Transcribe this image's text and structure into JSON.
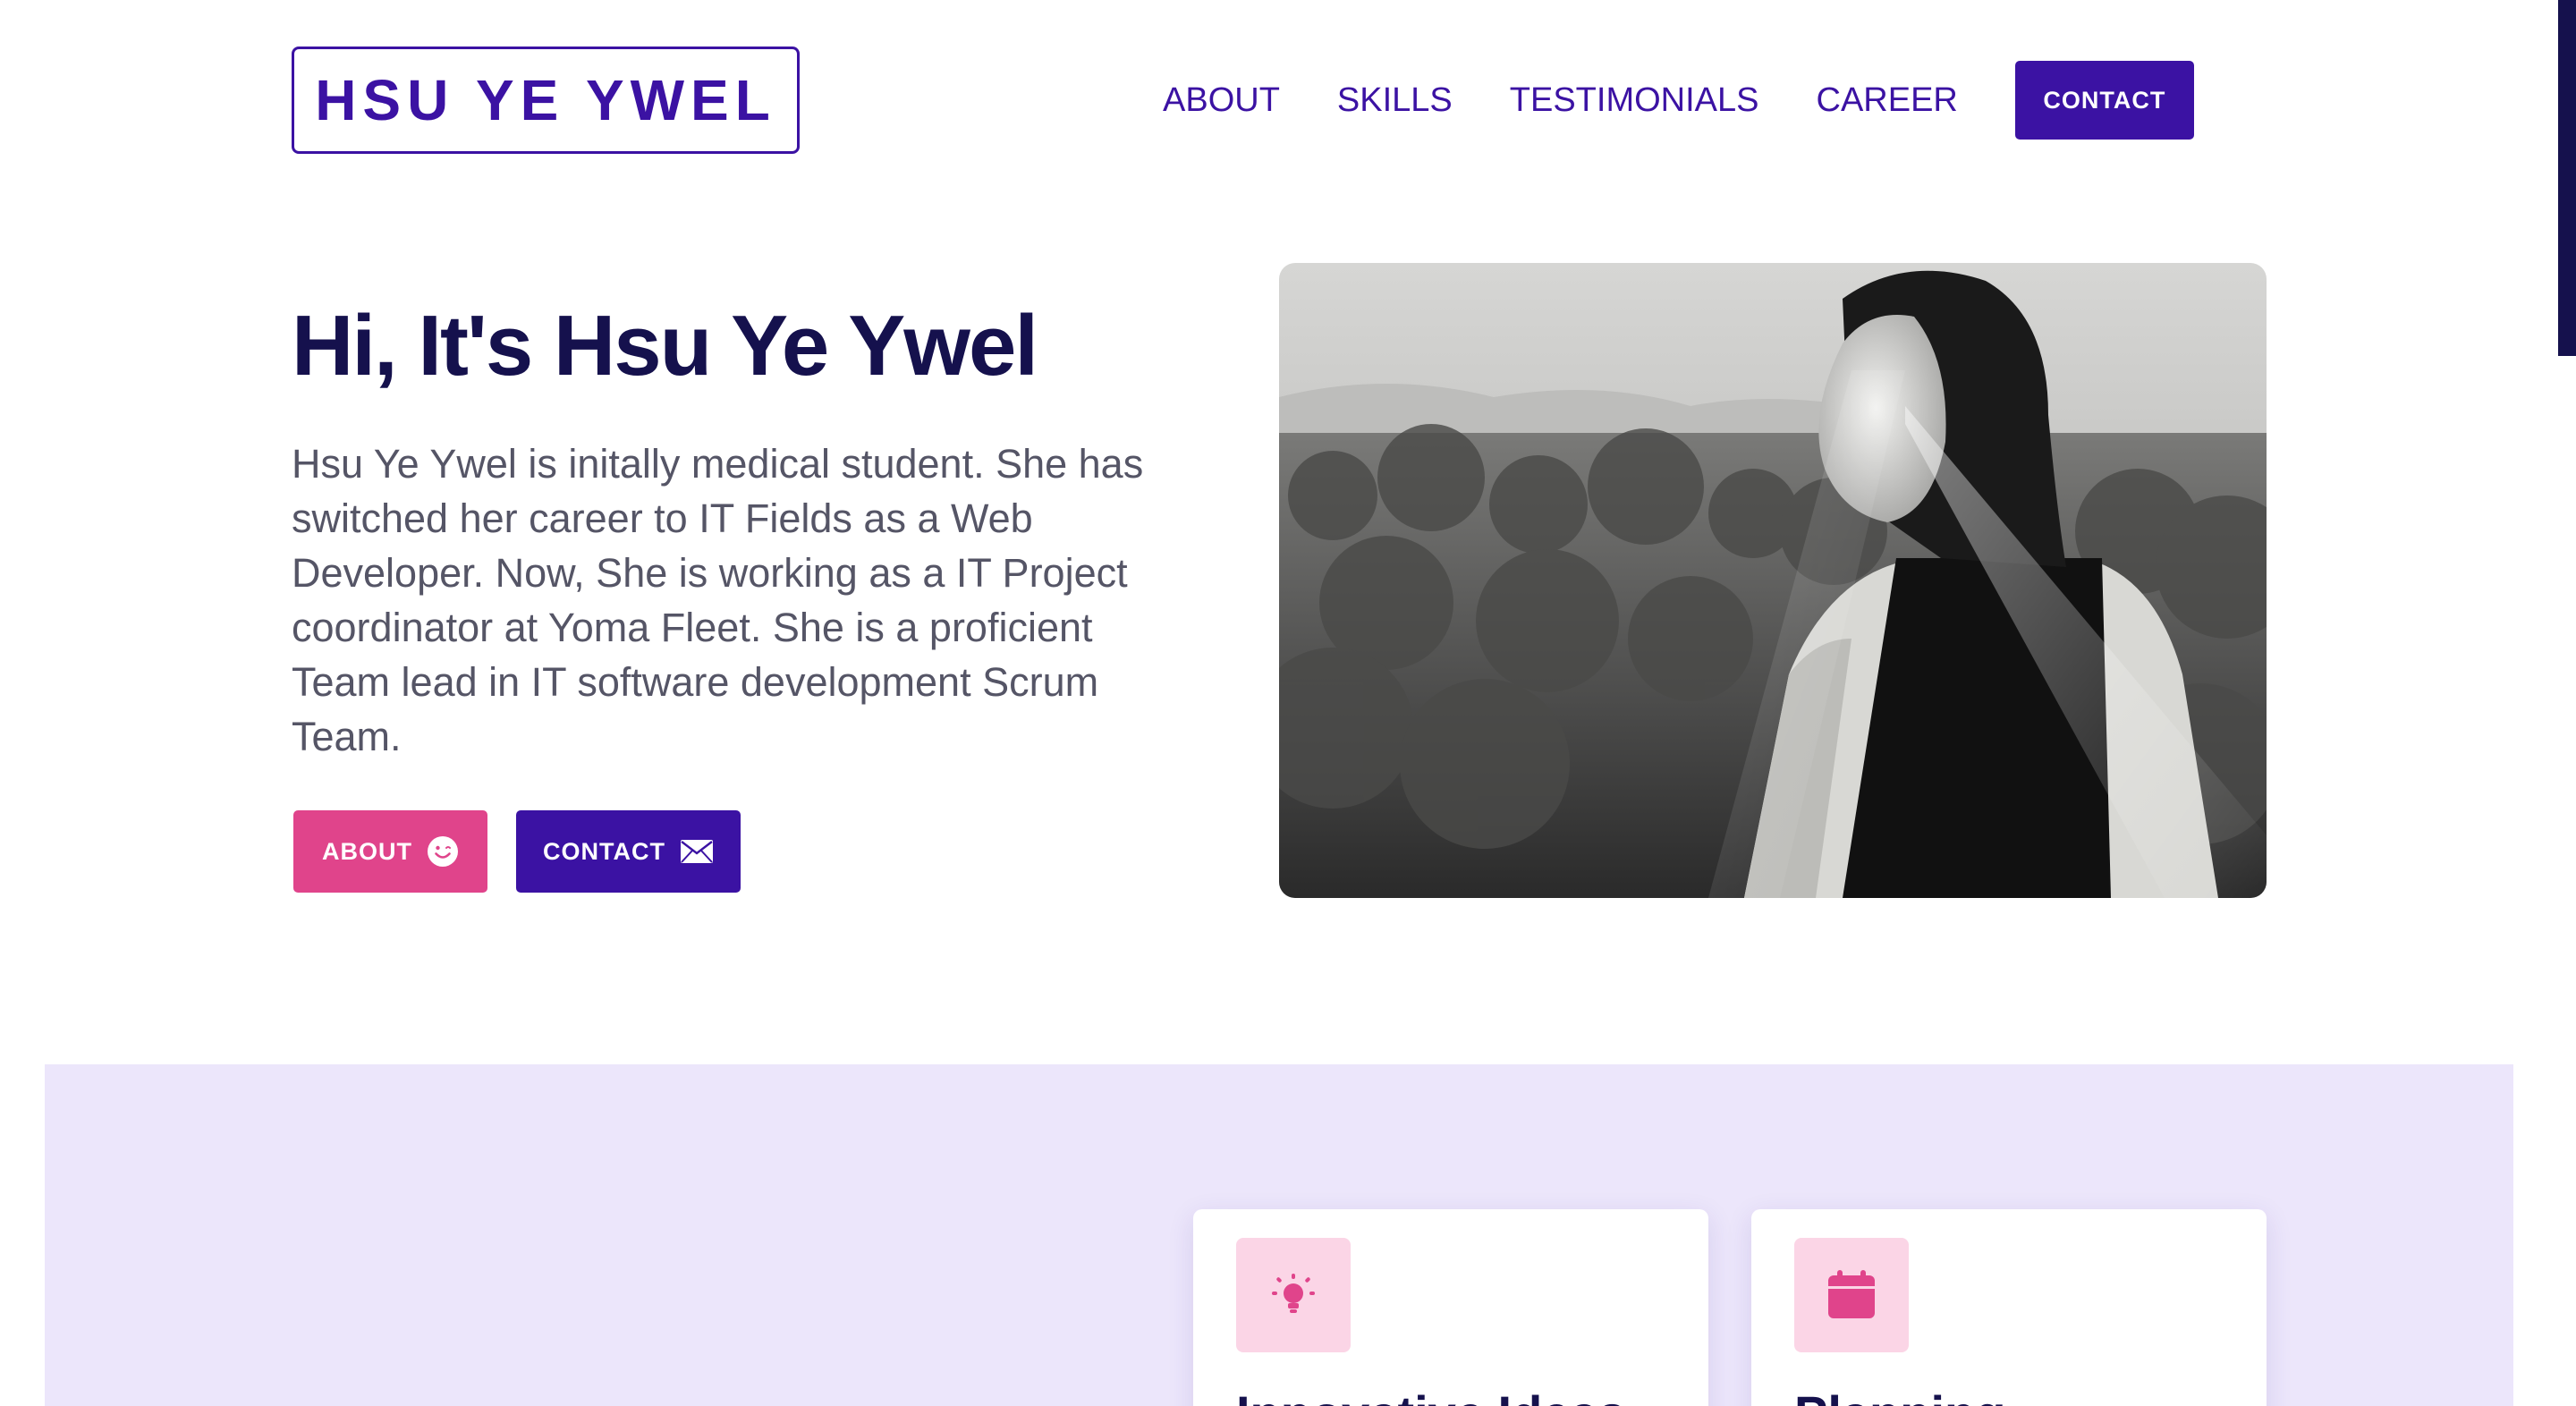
{
  "brand": {
    "name": "HSU YE YWEL"
  },
  "nav": {
    "links": [
      "ABOUT",
      "SKILLS",
      "TESTIMONIALS",
      "CAREER"
    ],
    "contact_label": "CONTACT"
  },
  "hero": {
    "title": "Hi, It's Hsu Ye Ywel",
    "description": "Hsu Ye Ywel is initally medical student. She has switched her career to IT Fields as a Web Developer. Now, She is working as a IT Project coordinator at Yoma Fleet. She is a proficient Team lead in IT software development Scrum Team.",
    "about_button": "ABOUT",
    "about_icon": "smile-icon",
    "contact_button": "CONTACT",
    "contact_icon": "envelope-icon"
  },
  "features": [
    {
      "title": "Innovative Ideas",
      "icon": "lightbulb-icon"
    },
    {
      "title": "Planning",
      "icon": "calendar-icon"
    }
  ],
  "colors": {
    "primary": "#3b12a3",
    "accent": "#e0448b",
    "heading": "#15114d",
    "band": "#ece6fb"
  }
}
